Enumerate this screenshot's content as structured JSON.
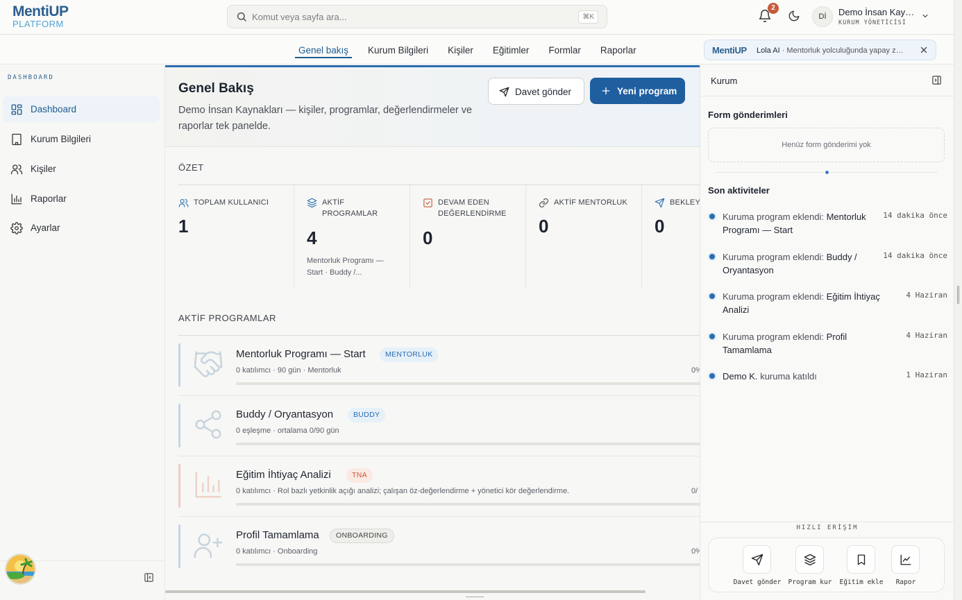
{
  "brand": {
    "line1": "MentiUP",
    "line2": "PLATFORM"
  },
  "search": {
    "placeholder": "Komut veya sayfa ara...",
    "shortcut": "⌘K"
  },
  "header": {
    "notification_count": "2",
    "user_initials": "Dİ",
    "user_name": "Demo İnsan Kaynakları",
    "user_role": "KURUM YÖNETİCİSİ"
  },
  "nav": {
    "tabs": [
      "Genel bakış",
      "Kurum Bilgileri",
      "Kişiler",
      "Eğitimler",
      "Formlar",
      "Raporlar"
    ],
    "active": "Genel bakış"
  },
  "lola": {
    "logo": "MentiUP",
    "name": "Lola AI",
    "text": " · Mentorluk yolculuğunda yapay zeka asistanınız"
  },
  "sidebar": {
    "label": "DASHBOARD",
    "items": [
      {
        "label": "Dashboard",
        "icon": "grid-icon",
        "active": true
      },
      {
        "label": "Kurum Bilgileri",
        "icon": "building-icon"
      },
      {
        "label": "Kişiler",
        "icon": "users-icon"
      },
      {
        "label": "Raporlar",
        "icon": "bar-chart-icon"
      },
      {
        "label": "Ayarlar",
        "icon": "gear-icon"
      }
    ]
  },
  "hero": {
    "title": "Genel Bakış",
    "subtitle": "Demo İnsan Kaynakları — kişiler, programlar, değerlendirmeler ve raporlar tek panelde.",
    "invite_label": "Davet gönder",
    "new_label": "Yeni program"
  },
  "summary": {
    "title": "ÖZET",
    "stats": [
      {
        "label": "TOPLAM KULLANICI",
        "value": "1",
        "sub": ""
      },
      {
        "label": "AKTİF PROGRAMLAR",
        "value": "4",
        "sub": "Mentorluk Programı — Start · Buddy /..."
      },
      {
        "label": "DEVAM EDEN DEĞERLENDİRME",
        "value": "0",
        "sub": ""
      },
      {
        "label": "AKTİF MENTORLUK",
        "value": "0",
        "sub": ""
      },
      {
        "label": "BEKLEYEN",
        "value": "0",
        "sub": ""
      }
    ]
  },
  "programs": {
    "title": "AKTİF PROGRAMLAR",
    "items": [
      {
        "name": "Mentorluk Programı — Start",
        "tag": "MENTORLUK",
        "desc": "0 katılımcı · 90 gün · Mentorluk",
        "pct": "0%",
        "progress": 0,
        "color": "#2b6db0"
      },
      {
        "name": "Buddy / Oryantasyon",
        "tag": "BUDDY",
        "desc": "0 eşleşme · ortalama 0/90 gün",
        "pct": "",
        "progress": 0,
        "color": "#2b6db0"
      },
      {
        "name": "Eğitim İhtiyaç Analizi",
        "tag": "TNA",
        "desc": "0 katılımcı · Rol bazlı yetkinlik açığı analizi; çalışan öz-değerlendirme + yönetici kör değerlendirme.",
        "pct": "0/",
        "progress": 0,
        "color": "#c85a3a"
      },
      {
        "name": "Profil Tamamlama",
        "tag": "ONBOARDING",
        "desc": "0 katılımcı · Onboarding",
        "pct": "0%",
        "progress": 0,
        "color": "#2b6db0"
      }
    ]
  },
  "rpanel": {
    "title": "Kurum",
    "forms_title": "Form gönderimleri",
    "forms_empty": "Henüz form gönderimi yok",
    "activity_title": "Son aktiviteler",
    "activities": [
      {
        "prefix": "Kuruma program eklendi: ",
        "bold": "Mentorluk Programı — Start",
        "suffix": "",
        "time": "14 dakika önce"
      },
      {
        "prefix": "Kuruma program eklendi: ",
        "bold": "Buddy / Oryantasyon",
        "suffix": "",
        "time": "14 dakika önce"
      },
      {
        "prefix": "Kuruma program eklendi: ",
        "bold": "Eğitim İhtiyaç Analizi",
        "suffix": "",
        "time": "4 Haziran"
      },
      {
        "prefix": "Kuruma program eklendi: ",
        "bold": "Profil Tamamlama",
        "suffix": "",
        "time": "4 Haziran"
      },
      {
        "prefix": "",
        "bold": "Demo K.",
        "suffix": " kuruma katıldı",
        "time": "1 Haziran"
      }
    ],
    "quick_title": "HIZLI ERİŞİM",
    "quick": [
      {
        "label": "Davet gönder",
        "icon": "send-icon"
      },
      {
        "label": "Program kur",
        "icon": "layers-icon"
      },
      {
        "label": "Eğitim ekle",
        "icon": "bookmark-icon"
      },
      {
        "label": "Rapor",
        "icon": "line-chart-icon"
      }
    ]
  }
}
